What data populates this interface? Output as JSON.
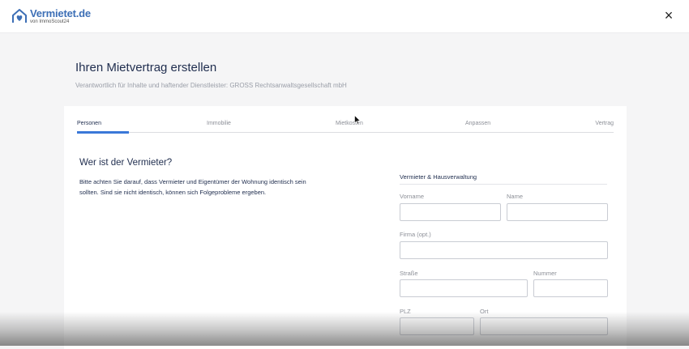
{
  "header": {
    "logo_name": "Vermietet.de",
    "logo_tagline": "von ImmoScout24",
    "logo_icon": "house-heart-icon",
    "close_icon": "×",
    "brand_color": "#3d6fb6"
  },
  "main": {
    "title": "Ihren Mietvertrag erstellen",
    "subtitle": "Verantwortlich für Inhalte und haftender Dienstleister: GROSS Rechtsanwaltsgesellschaft mbH"
  },
  "steps": {
    "items": [
      {
        "label": "Personen",
        "active": true
      },
      {
        "label": "Immobilie",
        "active": false
      },
      {
        "label": "Mietkosten",
        "active": false
      },
      {
        "label": "Anpassen",
        "active": false
      },
      {
        "label": "Vertrag",
        "active": false
      }
    ],
    "accent_color": "#3a78d8"
  },
  "section": {
    "title": "Wer ist der Vermieter?",
    "info": "Bitte achten Sie darauf, dass Vermieter und Eigentümer der Wohnung identisch sein sollten. Sind sie nicht identisch, können sich Folgeprobleme ergeben."
  },
  "form": {
    "group_title": "Vermieter & Hausverwaltung",
    "fields": {
      "vorname": {
        "label": "Vorname",
        "value": ""
      },
      "name": {
        "label": "Name",
        "value": ""
      },
      "firma": {
        "label": "Firma (opt.)",
        "value": ""
      },
      "strasse": {
        "label": "Straße",
        "value": ""
      },
      "nummer": {
        "label": "Nummer",
        "value": ""
      },
      "plz": {
        "label": "PLZ",
        "value": ""
      },
      "ort": {
        "label": "Ort",
        "value": ""
      }
    }
  }
}
